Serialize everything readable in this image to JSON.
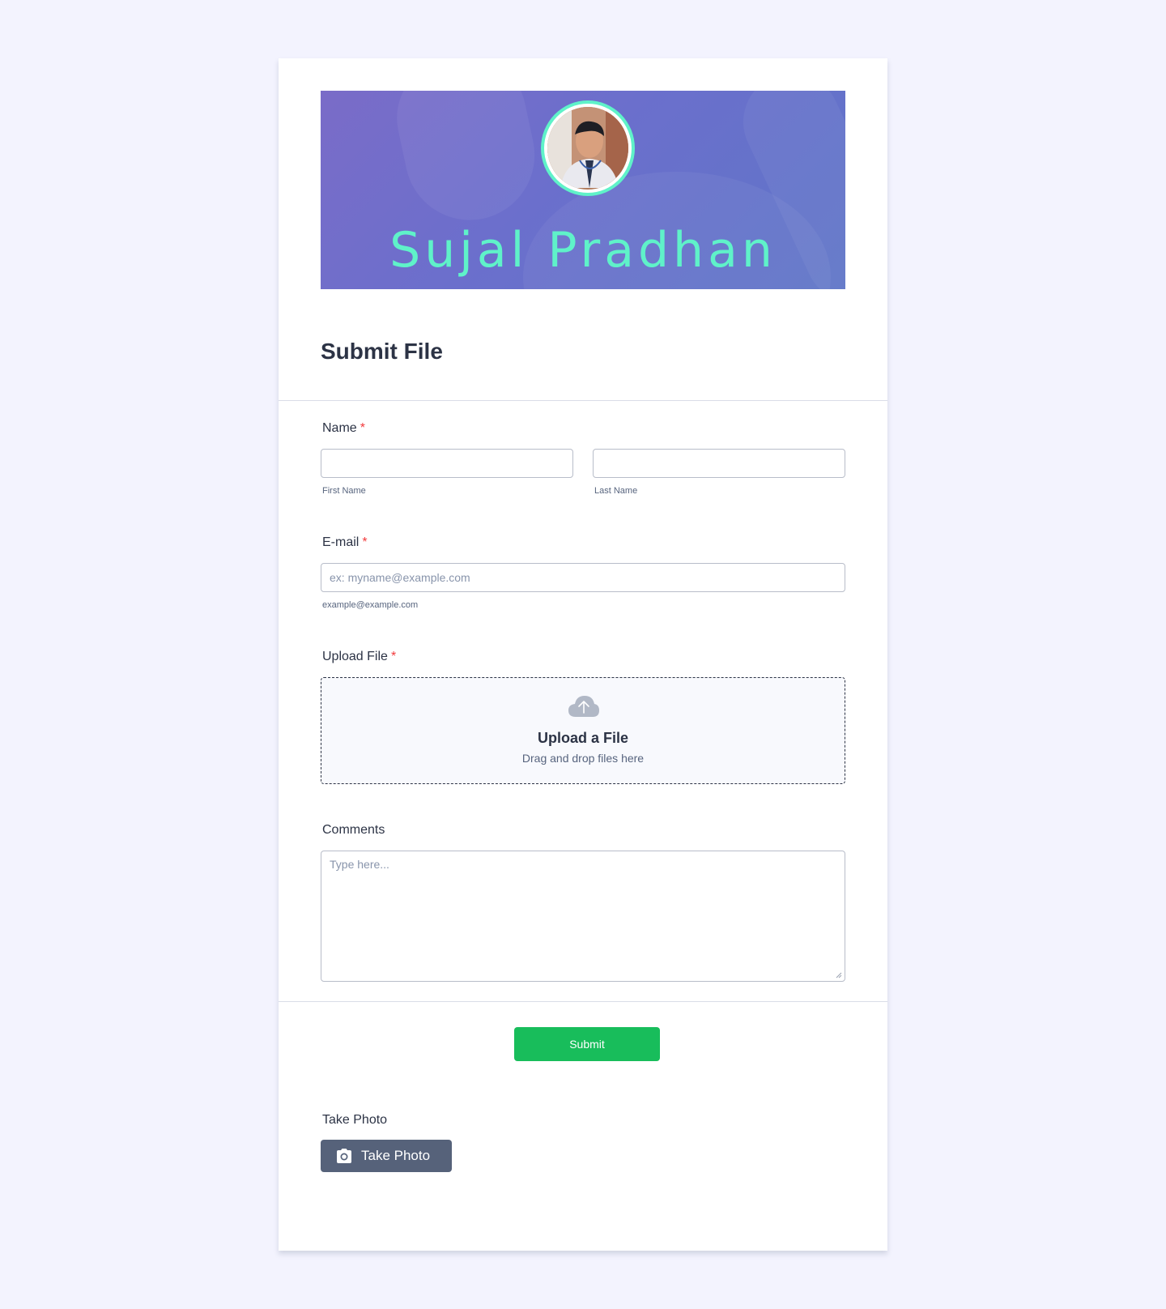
{
  "banner": {
    "name": "Sujal Pradhan",
    "accent_color": "#5ff2c9",
    "background_color": "#6f6fcb"
  },
  "form": {
    "title": "Submit File",
    "name_field": {
      "label": "Name",
      "required_mark": "*",
      "first_value": "",
      "last_value": "",
      "first_sublabel": "First Name",
      "last_sublabel": "Last Name"
    },
    "email_field": {
      "label": "E-mail",
      "required_mark": "*",
      "placeholder": "ex: myname@example.com",
      "sublabel": "example@example.com"
    },
    "upload_field": {
      "label": "Upload File",
      "required_mark": "*",
      "icon": "cloud-upload-icon",
      "title": "Upload a File",
      "subtitle": "Drag and drop files here"
    },
    "comments_field": {
      "label": "Comments",
      "placeholder": "Type here..."
    },
    "submit": {
      "label": "Submit",
      "color": "#18bd5b"
    },
    "photo_field": {
      "label": "Take Photo",
      "button_label": "Take Photo",
      "icon": "camera-icon",
      "button_color": "#56627a"
    }
  }
}
